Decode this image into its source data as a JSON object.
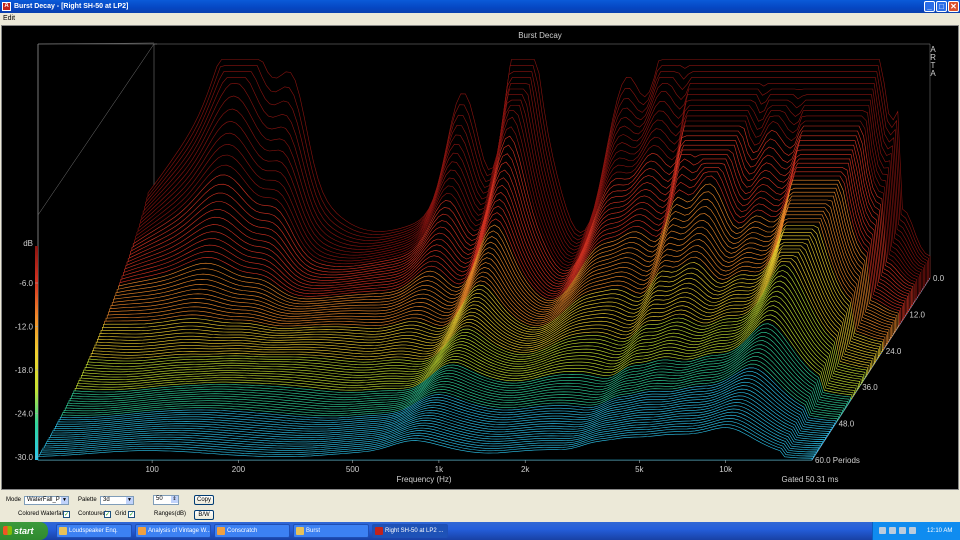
{
  "window": {
    "title": "Burst Decay - [Right SH-50 at LP2]",
    "icon_label": "A",
    "minimize_label": "_",
    "maximize_label": "□",
    "close_label": "✕"
  },
  "menu": {
    "items": [
      "Edit"
    ]
  },
  "chart_data": {
    "type": "waterfall",
    "title": "Burst Decay",
    "watermark": [
      "A",
      "R",
      "T",
      "A"
    ],
    "z_axis": {
      "label": "dB",
      "ticks": [
        "-6.0",
        "-12.0",
        "-18.0",
        "-24.0",
        "-30.0"
      ]
    },
    "x_axis": {
      "label": "Frequency (Hz)",
      "ticks": [
        "100",
        "200",
        "500",
        "1k",
        "2k",
        "5k",
        "10k"
      ],
      "scale": "log",
      "range_hz": [
        40,
        20000
      ]
    },
    "y_axis": {
      "ticks": [
        "0.0",
        "12.0",
        "24.0",
        "36.0",
        "48.0",
        "60.0 Periods"
      ],
      "range_periods": [
        0,
        60
      ]
    },
    "gated_label": "Gated 50.31 ms",
    "color_scale": [
      "#2ec8f0",
      "#31d59d",
      "#c8e332",
      "#f0d030",
      "#f08a2a",
      "#d43222",
      "#8a1410"
    ],
    "grid": false,
    "floor_color": "#2f6ec9"
  },
  "controls": {
    "mode_label": "Mode",
    "mode_value": "WaterFall_P",
    "palette_label": "Palette",
    "palette_value": "3d",
    "spin_value": "50",
    "copy_label": "Copy",
    "colored_waterfall_label": "Colored Waterfall",
    "contoured_label": "Contoured",
    "grid_label": "Grid",
    "ranges_label": "Ranges(dB)",
    "bw_label": "B/W",
    "check_mark": "✓"
  },
  "taskbar": {
    "start_label": "start",
    "tasks": [
      {
        "label": "Loudspeaker Enq."
      },
      {
        "label": "Analysis of Vintage W..."
      },
      {
        "label": "Conscratch"
      },
      {
        "label": "Burst"
      },
      {
        "label": "Right SH-50 at LP2 ..."
      }
    ],
    "clock": "12:10 AM"
  }
}
